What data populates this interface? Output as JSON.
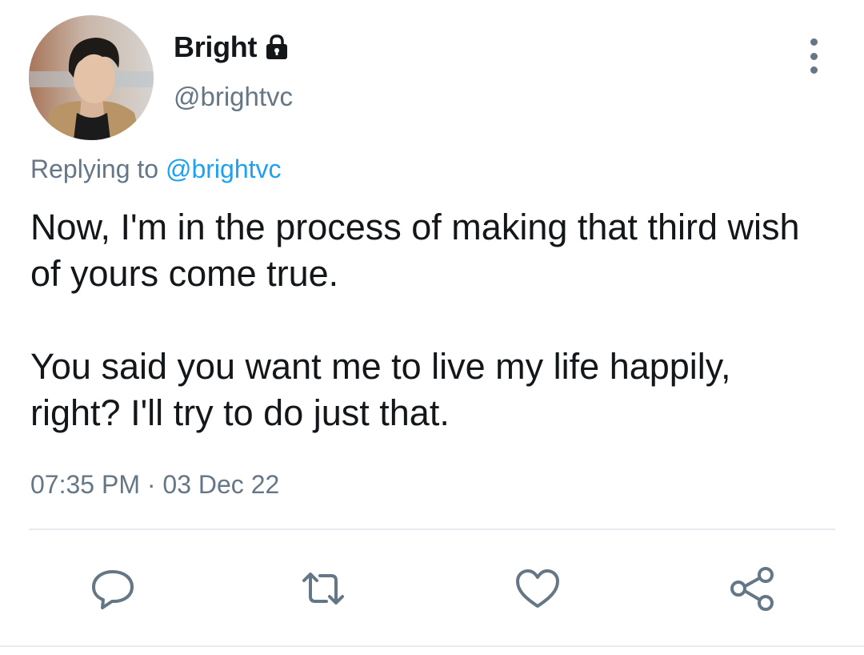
{
  "author": {
    "display_name": "Bright",
    "handle": "@brightvc",
    "avatar_icon": "profile-photo",
    "protected_icon": "lock-icon"
  },
  "reply": {
    "prefix": "Replying to",
    "mention": "@brightvc"
  },
  "tweet": {
    "paragraphs": [
      "Now, I'm in the process of making that third wish of yours come true.",
      "You said you want me to live my life happily, right? I'll try to do just that."
    ],
    "timestamp": "07:35 PM · 03 Dec 22"
  },
  "actions": {
    "reply_icon": "reply-icon",
    "retweet_icon": "retweet-icon",
    "like_icon": "heart-icon",
    "share_icon": "share-icon"
  },
  "colors": {
    "text_primary": "#14171a",
    "text_secondary": "#657786",
    "link": "#1da1f2",
    "divider": "#e6ecf0"
  }
}
